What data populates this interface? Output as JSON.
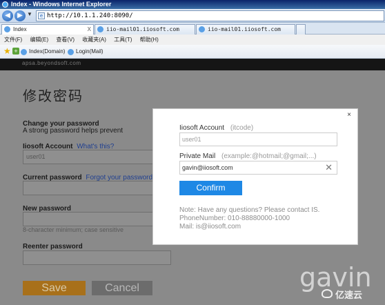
{
  "window": {
    "title": "Index - Windows Internet Explorer"
  },
  "addressbar": {
    "url": "http://10.1.1.240:8090/"
  },
  "tabs": [
    {
      "label": "Index"
    },
    {
      "label": "iio-mail01.iiosoft.com"
    },
    {
      "label": "iio-mail01.iiosoft.com"
    }
  ],
  "menu": [
    "文件(F)",
    "编辑(E)",
    "查看(V)",
    "收藏夹(A)",
    "工具(T)",
    "帮助(H)"
  ],
  "favorites": [
    {
      "label": "Index(Domain)"
    },
    {
      "label": "Login(Mail)"
    }
  ],
  "page": {
    "brand": "apsa.beyondsoft.com",
    "title": "修改密码",
    "change_heading": "Change your password",
    "change_sub": "A strong password helps prevent",
    "account_label": "Iiosoft Account",
    "account_link": "What's this?",
    "account_value": "user01",
    "current_label": "Current password",
    "current_link": "Forgot your password?",
    "new_label": "New password",
    "new_hint": "8-character minimum; case sensitive",
    "reenter_label": "Reenter password",
    "save_label": "Save",
    "cancel_label": "Cancel"
  },
  "modal": {
    "close": "×",
    "account_label": "Iiosoft Account",
    "account_hint": "(itcode)",
    "account_value": "user01",
    "mail_label": "Private Mail",
    "mail_hint": "(example:@hotmail;@gmail;...)",
    "mail_value": "gavin@iiosoft.com",
    "confirm_label": "Confirm",
    "note_line1": "Note: Have any questions? Please contact IS.",
    "note_line2": "PhoneNumber: 010-88880000-1000",
    "note_line3": "Mail: is@iiosoft.com"
  },
  "watermarks": {
    "gavin": "gavin",
    "yisu": "亿速云"
  }
}
